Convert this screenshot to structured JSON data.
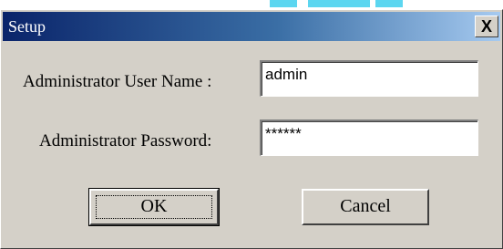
{
  "window": {
    "title": "Setup",
    "close_label": "X"
  },
  "form": {
    "username_label": "Administrator User Name :",
    "username_value": "admin",
    "password_label": "Administrator Password:",
    "password_value": "******"
  },
  "buttons": {
    "ok_label": "OK",
    "cancel_label": "Cancel"
  },
  "colors": {
    "titlebar_start": "#0a246a",
    "titlebar_end": "#a6caf0",
    "dialog_face": "#d4d0c8",
    "decoration_cyan": "#5cd6f0"
  },
  "icons": {
    "close": "close-icon"
  }
}
